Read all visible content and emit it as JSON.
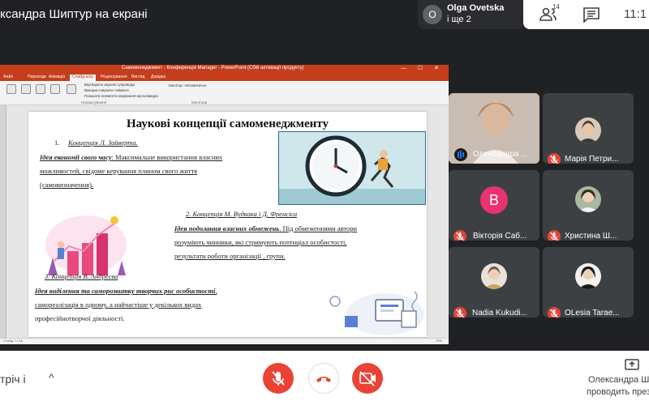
{
  "meet": {
    "presentation_title": "ксандра Шиптур на екрані",
    "presenter": {
      "avatar_letter": "O",
      "name": "Olga Ovetska",
      "sub": "і ще 2"
    },
    "people_count": "14",
    "time": "11:1",
    "bottom": {
      "meeting_title": "тріч і",
      "presenting_label": "Олександра Ш",
      "presenting_sub": "проводить прези"
    },
    "colors": {
      "red": "#ea4335",
      "pink_avatar": "#e8336f",
      "dark": "#202124"
    }
  },
  "participants": [
    {
      "name": "Олександра ...",
      "type": "video",
      "mic": "active"
    },
    {
      "name": "Марія Петри...",
      "type": "photo",
      "mic": "muted"
    },
    {
      "name": "Вікторія Саб...",
      "type": "letter",
      "letter": "В",
      "mic": "muted"
    },
    {
      "name": "Христина Ш...",
      "type": "photo",
      "mic": "muted"
    },
    {
      "name": "Nadia Kukudi...",
      "type": "photo",
      "mic": "muted"
    },
    {
      "name": "OLesia Tarae...",
      "type": "photo",
      "mic": "muted"
    }
  ],
  "powerpoint": {
    "window_title": "Самоменеджмент - Конференція Manager - PowerPoint (Сбій активації продукту)",
    "tabs": [
      "Файл",
      "Основне",
      "Вставлення",
      "Конструктор",
      "Переходи",
      "Анімація",
      "Слайд-шоу",
      "Рецензування",
      "Вигляд",
      "Довідка"
    ],
    "active_tab": "Слайд-шоу",
    "ribbon_groups": [
      "Налаштування",
      "Монітори"
    ],
    "checks": [
      "Відтворити звукові супроводи",
      "Використовувати таймінги",
      "Показати елементи керування мультимедіа"
    ],
    "monitor_label": "Монітор: Автоматично",
    "status_left": "Слайд 7 з 16",
    "zoom": "73%"
  },
  "slide": {
    "title": "Наукові концепції самоменеджменту",
    "c1_num": "1.",
    "c1_header": "Концепція Л. Зайверта.",
    "c1_idea": "Ідея економії свого часу",
    "c1_text1": ": Максимальне використання власних",
    "c1_text2": "можливостей, свідоме керування плином свого життя",
    "c1_text3": "(самовизначення).",
    "c2_header": "2. Концепція М. Вудкока і Д. Френсіса",
    "c2_idea": "Ідея подолання власних обмежень",
    "c2_text1": ". Під обмеженнями автори",
    "c2_text2": "розуміють чинники, які стримують потенціал особистості,",
    "c2_text3": "результати роботи організації , групи.",
    "c3_header": "3. Концепція В. Андреєва",
    "c3_idea": "Ідея виділення та саморозвитку творчих рис особистості",
    "c3_text1": "самореалізація в одному, а найчастіше у декількох видах",
    "c3_text2": "професійнотворчої діяльності."
  }
}
